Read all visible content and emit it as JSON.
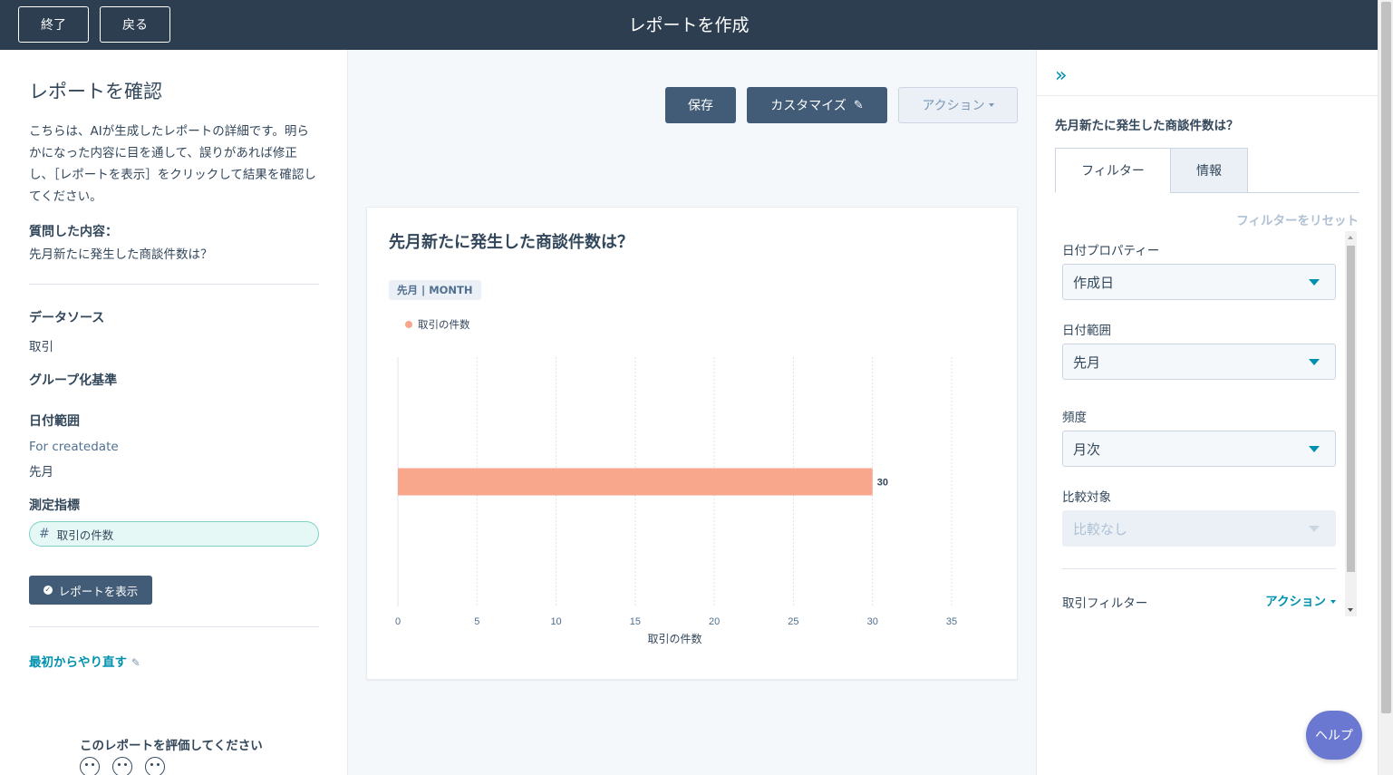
{
  "header": {
    "exit_label": "終了",
    "back_label": "戻る",
    "title": "レポートを作成"
  },
  "left": {
    "heading": "レポートを確認",
    "description": "こちらは、AIが生成したレポートの詳細です。明らかになった内容に目を通して、誤りがあれば修正し、［レポートを表示］をクリックして結果を確認してください。",
    "asked_label": "質問した内容：",
    "asked_value": "先月新たに発生した商談件数は？",
    "datasource_label": "データソース",
    "datasource_value": "取引",
    "groupby_label": "グループ化基準",
    "daterange_label": "日付範囲",
    "daterange_for": "For createdate",
    "daterange_value": "先月",
    "metric_label": "測定指標",
    "metric_value": "取引の件数",
    "show_report_label": "レポートを表示",
    "restart_label": "最初からやり直す",
    "rate_label": "このレポートを評価してください"
  },
  "toolbar": {
    "save_label": "保存",
    "customize_label": "カスタマイズ",
    "actions_label": "アクション"
  },
  "card": {
    "title": "先月新たに発生した商談件数は？",
    "chip": "先月 | MONTH"
  },
  "chart_data": {
    "type": "bar",
    "orientation": "horizontal",
    "categories": [
      ""
    ],
    "series": [
      {
        "name": "取引の件数",
        "values": [
          30
        ],
        "color": "#f8a68c"
      }
    ],
    "data_labels": [
      "30"
    ],
    "xlabel": "取引の件数",
    "ylabel": "",
    "xlim": [
      0,
      35
    ],
    "xticks": [
      0,
      5,
      10,
      15,
      20,
      25,
      30,
      35
    ],
    "grid": true,
    "legend_position": "top-left"
  },
  "right": {
    "question": "先月新たに発生した商談件数は？",
    "tabs": [
      {
        "label": "フィルター",
        "active": true
      },
      {
        "label": "情報",
        "active": false
      }
    ],
    "reset_label": "フィルターをリセット",
    "date_property_label": "日付プロパティー",
    "date_property_value": "作成日",
    "date_range_label": "日付範囲",
    "date_range_value": "先月",
    "frequency_label": "頻度",
    "frequency_value": "月次",
    "compare_label": "比較対象",
    "compare_value": "比較なし",
    "deal_filter_label": "取引フィルター",
    "deal_filter_action": "アクション"
  },
  "help_label": "ヘルプ",
  "colors": {
    "header_bg": "#2d3e50",
    "primary_button": "#425b76",
    "accent": "#0091ae",
    "bar": "#f8a68c",
    "metric_pill_bg": "#e5f8f6",
    "help_bg": "#6a78d1"
  }
}
